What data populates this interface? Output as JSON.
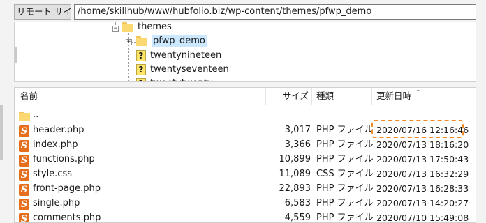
{
  "path_bar": {
    "label": "リモート サイト:",
    "path": "/home/skillhub/www/hubfolio.biz/wp-content/themes/pfwp_demo"
  },
  "tree": {
    "nodes": [
      {
        "name": "themes",
        "icon": "folder-icon",
        "expander": "−"
      },
      {
        "name": "pfwp_demo",
        "icon": "folder-icon",
        "expander": "+",
        "selected": true
      },
      {
        "name": "twentynineteen",
        "icon": "unknown-folder-icon"
      },
      {
        "name": "twentyseventeen",
        "icon": "unknown-folder-icon"
      },
      {
        "name": "twentytwenty",
        "icon": "unknown-folder-icon"
      }
    ]
  },
  "file_list": {
    "columns": {
      "name": "名前",
      "size": "サイズ",
      "type": "種類",
      "modified": "更新日時"
    },
    "parent_dir": "..",
    "rows": [
      {
        "name": "header.php",
        "size": "3,017",
        "type": "PHP ファイル",
        "modified": "2020/07/16 12:16:46"
      },
      {
        "name": "index.php",
        "size": "3,366",
        "type": "PHP ファイル",
        "modified": "2020/07/13 18:16:20"
      },
      {
        "name": "functions.php",
        "size": "10,899",
        "type": "PHP ファイル",
        "modified": "2020/07/13 17:50:43"
      },
      {
        "name": "style.css",
        "size": "11,089",
        "type": "CSS ファイル",
        "modified": "2020/07/13 16:32:29"
      },
      {
        "name": "front-page.php",
        "size": "22,893",
        "type": "PHP ファイル",
        "modified": "2020/07/13 16:28:33"
      },
      {
        "name": "single.php",
        "size": "6,583",
        "type": "PHP ファイル",
        "modified": "2020/07/13 14:20:27"
      },
      {
        "name": "comments.php",
        "size": "4,559",
        "type": "PHP ファイル",
        "modified": "2020/07/10 15:49:08"
      }
    ]
  },
  "colors": {
    "highlight": "#f08a24",
    "file_icon": "#e66f1e",
    "folder": "#fcd873"
  }
}
